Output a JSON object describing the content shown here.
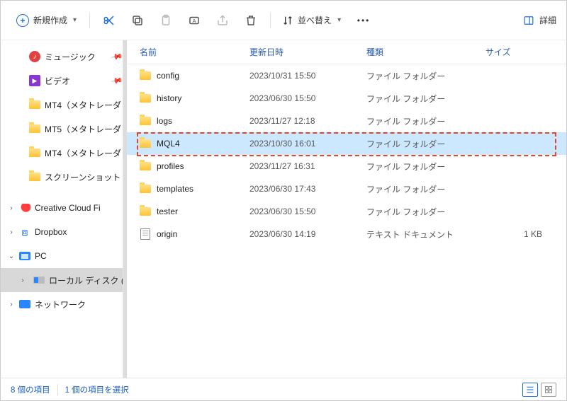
{
  "toolbar": {
    "new_label": "新規作成",
    "sort_label": "並べ替え",
    "details_label": "詳細"
  },
  "sidebar": {
    "music": "ミュージック",
    "video": "ビデオ",
    "mt4_1": "MT4（メタトレーダ",
    "mt5_1": "MT5（メタトレーダ",
    "mt4_2": "MT4（メタトレーダ",
    "screenshot": "スクリーンショット",
    "ccf": "Creative Cloud Fi",
    "dropbox": "Dropbox",
    "pc": "PC",
    "localdisk": "ローカル ディスク (",
    "network": "ネットワーク"
  },
  "columns": {
    "name": "名前",
    "date": "更新日時",
    "type": "種類",
    "size": "サイズ"
  },
  "rows": [
    {
      "name": "config",
      "date": "2023/10/31 15:50",
      "type": "ファイル フォルダー",
      "size": "",
      "kind": "folder",
      "selected": false
    },
    {
      "name": "history",
      "date": "2023/06/30 15:50",
      "type": "ファイル フォルダー",
      "size": "",
      "kind": "folder",
      "selected": false
    },
    {
      "name": "logs",
      "date": "2023/11/27 12:18",
      "type": "ファイル フォルダー",
      "size": "",
      "kind": "folder",
      "selected": false
    },
    {
      "name": "MQL4",
      "date": "2023/10/30 16:01",
      "type": "ファイル フォルダー",
      "size": "",
      "kind": "folder",
      "selected": true
    },
    {
      "name": "profiles",
      "date": "2023/11/27 16:31",
      "type": "ファイル フォルダー",
      "size": "",
      "kind": "folder",
      "selected": false
    },
    {
      "name": "templates",
      "date": "2023/06/30 17:43",
      "type": "ファイル フォルダー",
      "size": "",
      "kind": "folder",
      "selected": false
    },
    {
      "name": "tester",
      "date": "2023/06/30 15:50",
      "type": "ファイル フォルダー",
      "size": "",
      "kind": "folder",
      "selected": false
    },
    {
      "name": "origin",
      "date": "2023/06/30 14:19",
      "type": "テキスト ドキュメント",
      "size": "1 KB",
      "kind": "file",
      "selected": false
    }
  ],
  "status": {
    "count": "8 個の項目",
    "selection": "1 個の項目を選択"
  }
}
